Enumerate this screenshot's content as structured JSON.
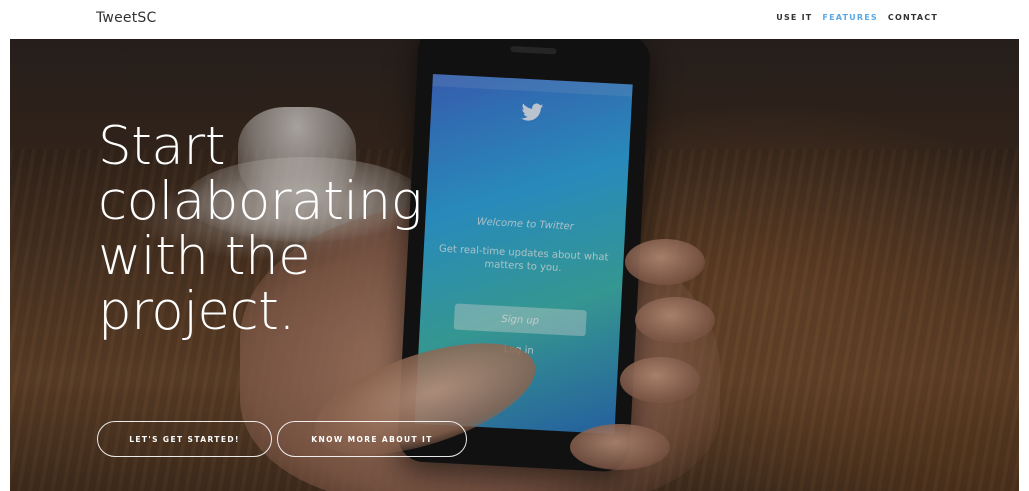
{
  "navbar": {
    "brand": "TweetSC",
    "links": [
      {
        "label": "USE IT",
        "active": false
      },
      {
        "label": "FEATURES",
        "active": true
      },
      {
        "label": "CONTACT",
        "active": false
      }
    ],
    "active_color": "#5aa9e6"
  },
  "hero": {
    "headline_lines": [
      "Start",
      "colaborating",
      "with the",
      "project."
    ],
    "buttons": {
      "primary": "LET'S GET STARTED!",
      "secondary": "KNOW MORE ABOUT IT"
    }
  },
  "phone_screen": {
    "welcome": "Welcome to Twitter",
    "tagline": "Get real-time updates about what matters to you.",
    "signup_label": "Sign up",
    "login_label": "Log in",
    "icon": "twitter-bird-icon"
  }
}
